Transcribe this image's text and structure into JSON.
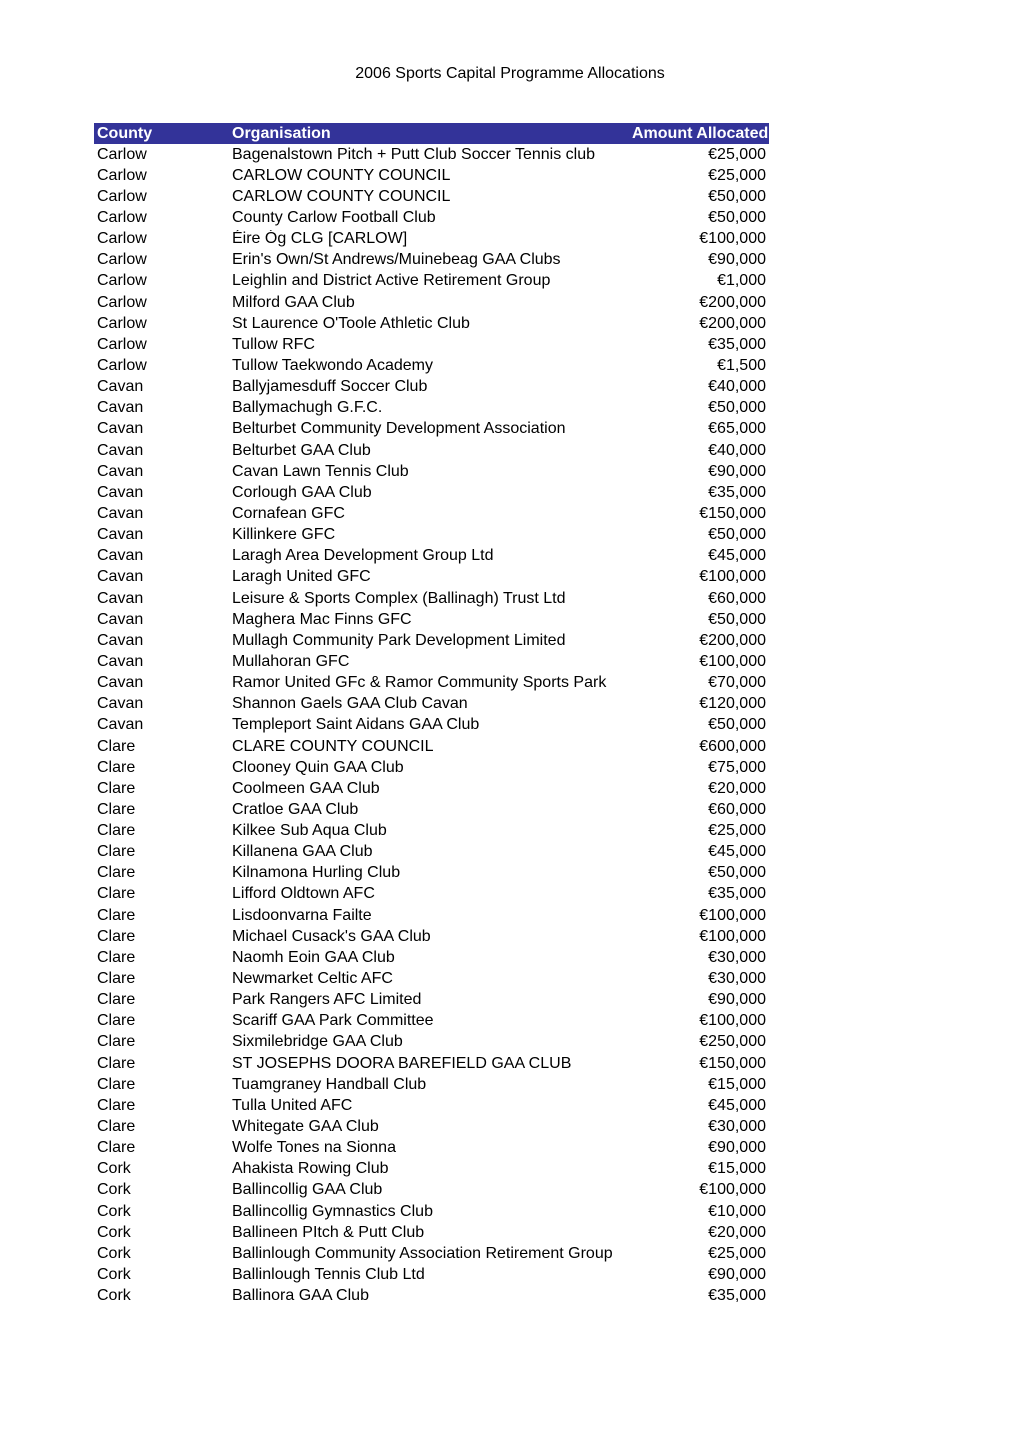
{
  "title": "2006 Sports Capital Programme Allocations",
  "headers": {
    "county": "County",
    "organisation": "Organisation",
    "amount": "Amount Allocated"
  },
  "rows": [
    {
      "county": "Carlow",
      "org": "Bagenalstown Pitch + Putt Club Soccer Tennis club",
      "amount": "€25,000"
    },
    {
      "county": "Carlow",
      "org": "CARLOW COUNTY COUNCIL",
      "amount": "€25,000"
    },
    {
      "county": "Carlow",
      "org": "CARLOW COUNTY COUNCIL",
      "amount": "€50,000"
    },
    {
      "county": "Carlow",
      "org": "County Carlow Football Club",
      "amount": "€50,000"
    },
    {
      "county": "Carlow",
      "org": "Éire Óg CLG [CARLOW]",
      "amount": "€100,000"
    },
    {
      "county": "Carlow",
      "org": "Erin's Own/St Andrews/Muinebeag GAA Clubs",
      "amount": "€90,000"
    },
    {
      "county": "Carlow",
      "org": "Leighlin and District Active Retirement Group",
      "amount": "€1,000"
    },
    {
      "county": "Carlow",
      "org": "Milford GAA Club",
      "amount": "€200,000"
    },
    {
      "county": "Carlow",
      "org": "St Laurence O'Toole Athletic Club",
      "amount": "€200,000"
    },
    {
      "county": "Carlow",
      "org": "Tullow RFC",
      "amount": "€35,000"
    },
    {
      "county": "Carlow",
      "org": "Tullow Taekwondo Academy",
      "amount": "€1,500"
    },
    {
      "county": "Cavan",
      "org": "Ballyjamesduff Soccer Club",
      "amount": "€40,000"
    },
    {
      "county": "Cavan",
      "org": "Ballymachugh G.F.C.",
      "amount": "€50,000"
    },
    {
      "county": "Cavan",
      "org": "Belturbet Community Development Association",
      "amount": "€65,000"
    },
    {
      "county": "Cavan",
      "org": "Belturbet GAA Club",
      "amount": "€40,000"
    },
    {
      "county": "Cavan",
      "org": "Cavan Lawn Tennis Club",
      "amount": "€90,000"
    },
    {
      "county": "Cavan",
      "org": "Corlough GAA Club",
      "amount": "€35,000"
    },
    {
      "county": "Cavan",
      "org": "Cornafean GFC",
      "amount": "€150,000"
    },
    {
      "county": "Cavan",
      "org": "Killinkere GFC",
      "amount": "€50,000"
    },
    {
      "county": "Cavan",
      "org": "Laragh Area Development Group Ltd",
      "amount": "€45,000"
    },
    {
      "county": "Cavan",
      "org": "Laragh United GFC",
      "amount": "€100,000"
    },
    {
      "county": "Cavan",
      "org": "Leisure & Sports Complex (Ballinagh) Trust Ltd",
      "amount": "€60,000"
    },
    {
      "county": "Cavan",
      "org": "Maghera Mac Finns GFC",
      "amount": "€50,000"
    },
    {
      "county": "Cavan",
      "org": "Mullagh Community Park Development Limited",
      "amount": "€200,000"
    },
    {
      "county": "Cavan",
      "org": "Mullahoran GFC",
      "amount": "€100,000"
    },
    {
      "county": "Cavan",
      "org": "Ramor United GFc & Ramor Community Sports Park",
      "amount": "€70,000"
    },
    {
      "county": "Cavan",
      "org": "Shannon Gaels GAA Club Cavan",
      "amount": "€120,000"
    },
    {
      "county": "Cavan",
      "org": "Templeport Saint Aidans GAA Club",
      "amount": "€50,000"
    },
    {
      "county": "Clare",
      "org": "CLARE COUNTY COUNCIL",
      "amount": "€600,000"
    },
    {
      "county": "Clare",
      "org": "Clooney Quin GAA Club",
      "amount": "€75,000"
    },
    {
      "county": "Clare",
      "org": "Coolmeen GAA Club",
      "amount": "€20,000"
    },
    {
      "county": "Clare",
      "org": "Cratloe GAA Club",
      "amount": "€60,000"
    },
    {
      "county": "Clare",
      "org": "Kilkee Sub Aqua Club",
      "amount": "€25,000"
    },
    {
      "county": "Clare",
      "org": "Killanena GAA Club",
      "amount": "€45,000"
    },
    {
      "county": "Clare",
      "org": "Kilnamona Hurling Club",
      "amount": "€50,000"
    },
    {
      "county": "Clare",
      "org": "Lifford Oldtown AFC",
      "amount": "€35,000"
    },
    {
      "county": "Clare",
      "org": "Lisdoonvarna Failte",
      "amount": "€100,000"
    },
    {
      "county": "Clare",
      "org": "Michael Cusack's GAA Club",
      "amount": "€100,000"
    },
    {
      "county": "Clare",
      "org": "Naomh Eoin GAA Club",
      "amount": "€30,000"
    },
    {
      "county": "Clare",
      "org": "Newmarket Celtic AFC",
      "amount": "€30,000"
    },
    {
      "county": "Clare",
      "org": "Park Rangers AFC Limited",
      "amount": "€90,000"
    },
    {
      "county": "Clare",
      "org": "Scariff GAA Park Committee",
      "amount": "€100,000"
    },
    {
      "county": "Clare",
      "org": "Sixmilebridge GAA Club",
      "amount": "€250,000"
    },
    {
      "county": "Clare",
      "org": "ST JOSEPHS DOORA BAREFIELD GAA CLUB",
      "amount": "€150,000"
    },
    {
      "county": "Clare",
      "org": "Tuamgraney Handball Club",
      "amount": "€15,000"
    },
    {
      "county": "Clare",
      "org": "Tulla United AFC",
      "amount": "€45,000"
    },
    {
      "county": "Clare",
      "org": "Whitegate GAA Club",
      "amount": "€30,000"
    },
    {
      "county": "Clare",
      "org": "Wolfe Tones na Sionna",
      "amount": "€90,000"
    },
    {
      "county": "Cork",
      "org": "Ahakista Rowing Club",
      "amount": "€15,000"
    },
    {
      "county": "Cork",
      "org": "Ballincollig GAA Club",
      "amount": "€100,000"
    },
    {
      "county": "Cork",
      "org": "Ballincollig Gymnastics Club",
      "amount": "€10,000"
    },
    {
      "county": "Cork",
      "org": "Ballineen PItch & Putt Club",
      "amount": "€20,000"
    },
    {
      "county": "Cork",
      "org": "Ballinlough Community Association Retirement Group",
      "amount": "€25,000"
    },
    {
      "county": "Cork",
      "org": "Ballinlough Tennis Club Ltd",
      "amount": "€90,000"
    },
    {
      "county": "Cork",
      "org": "Ballinora GAA Club",
      "amount": "€35,000"
    }
  ]
}
